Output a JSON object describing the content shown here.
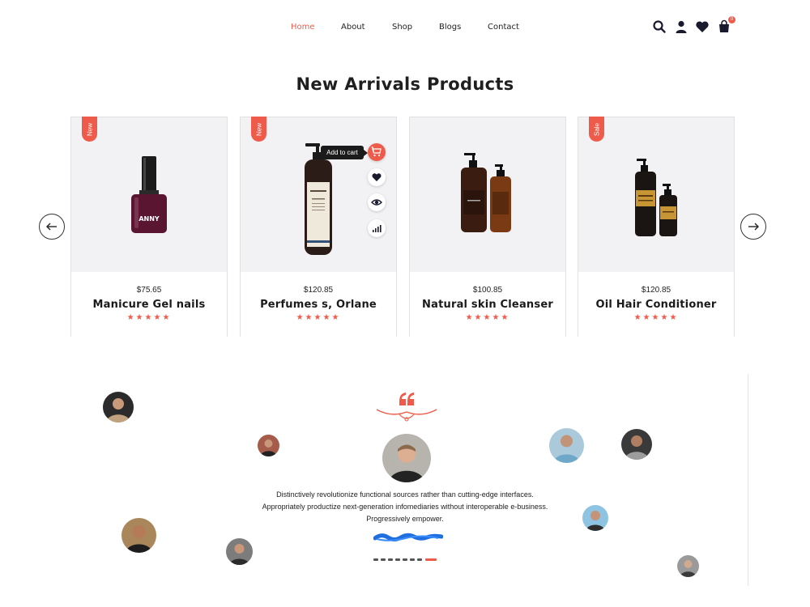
{
  "nav": {
    "items": [
      {
        "label": "Home",
        "active": true
      },
      {
        "label": "About",
        "active": false
      },
      {
        "label": "Shop",
        "active": false
      },
      {
        "label": "Blogs",
        "active": false
      },
      {
        "label": "Contact",
        "active": false
      }
    ],
    "icons": [
      "search-icon",
      "user-icon",
      "heart-icon",
      "bag-icon"
    ],
    "cart_count": "0"
  },
  "section": {
    "title": "New Arrivals Products"
  },
  "products": [
    {
      "tag": "New",
      "price": "$75.65",
      "name": "Manicure Gel nails",
      "stars": "★★★★★",
      "rating": 5
    },
    {
      "tag": "New",
      "price": "$120.85",
      "name": "Perfumes s, Orlane",
      "stars": "★★★★★",
      "rating": 5
    },
    {
      "tag": "",
      "price": "$100.85",
      "name": "Natural skin Cleanser",
      "stars": "★★★★★",
      "rating": 5
    },
    {
      "tag": "Sale",
      "price": "$120.85",
      "name": "Oil Hair Conditioner",
      "stars": "★★★★★",
      "rating": 5
    }
  ],
  "product_actions": {
    "tooltip": "Add to cart",
    "icons": [
      "cart-icon",
      "heart-icon",
      "eye-icon",
      "compare-icon"
    ]
  },
  "bottle_label": "ANNY",
  "testimonial": {
    "lines": [
      "Distinctively revolutionize functional sources rather than cutting-edge interfaces.",
      "Appropriately productize next-generation infomediaries without interoperable e-business.",
      "Progressively empower."
    ],
    "dots_total": 8,
    "dots_active": 8
  },
  "colors": {
    "accent": "#ef5b4a",
    "text": "#1c1c1c",
    "card_bg": "#f2f2f4"
  }
}
